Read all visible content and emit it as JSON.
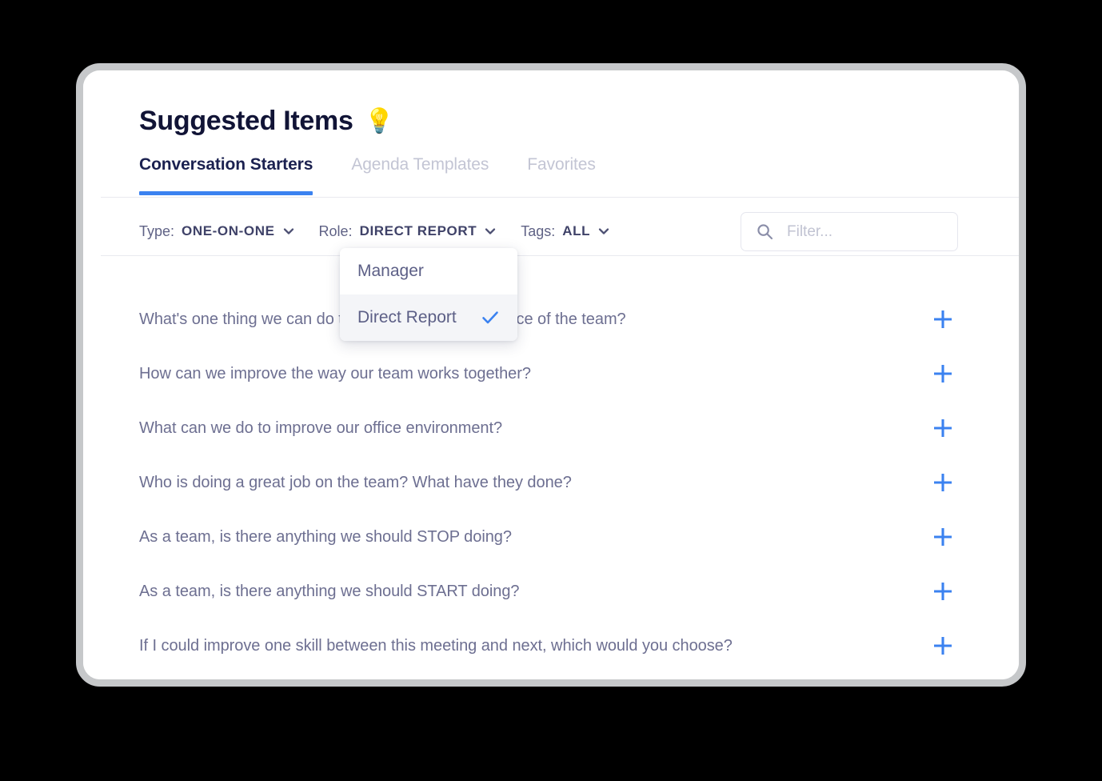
{
  "header": {
    "title": "Suggested Items",
    "bulb_icon": "lightbulb-icon",
    "bulb_glyph": "💡"
  },
  "tabs": [
    {
      "label": "Conversation Starters",
      "active": true
    },
    {
      "label": "Agenda Templates",
      "active": false
    },
    {
      "label": "Favorites",
      "active": false
    }
  ],
  "filters": [
    {
      "name": "type",
      "label": "Type:",
      "value": "ONE-ON-ONE"
    },
    {
      "name": "role",
      "label": "Role:",
      "value": "DIRECT REPORT"
    },
    {
      "name": "tags",
      "label": "Tags:",
      "value": "ALL"
    }
  ],
  "search": {
    "placeholder": "Filter...",
    "value": "",
    "icon": "search-icon"
  },
  "role_dropdown": {
    "open": true,
    "options": [
      {
        "label": "Manager",
        "selected": false
      },
      {
        "label": "Direct Report",
        "selected": true
      }
    ],
    "check_icon": "check-icon"
  },
  "list": {
    "add_icon": "plus-icon",
    "items": [
      {
        "text": "What's one thing we can do to improve the performance of the team?"
      },
      {
        "text": "How can we improve the way our team works together?"
      },
      {
        "text": "What can we do to improve our office environment?"
      },
      {
        "text": "Who is doing a great job on the team? What have they done?"
      },
      {
        "text": "As a team, is there anything we should STOP doing?"
      },
      {
        "text": "As a team, is there anything we should START doing?"
      },
      {
        "text": "If I could improve one skill between this meeting and next, which would you choose?"
      }
    ]
  },
  "colors": {
    "accent": "#3b82f0",
    "title": "#111436",
    "body_text": "#6d6f91",
    "muted": "#c3c5d4",
    "card_border": "#c6c8ca",
    "page_bg": "#000000"
  }
}
